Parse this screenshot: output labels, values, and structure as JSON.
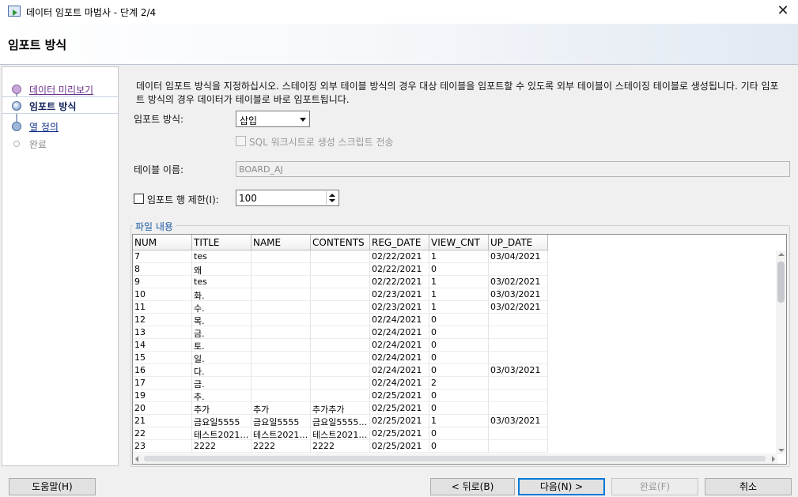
{
  "window": {
    "title": "데이터 임포트 마법사 - 단계 2/4",
    "close_glyph": "✕"
  },
  "header": {
    "title": "임포트 방식"
  },
  "nav": {
    "items": [
      {
        "label": "데이터 미리보기",
        "state": "done"
      },
      {
        "label": "임포트 방식",
        "state": "current"
      },
      {
        "label": "열 정의",
        "state": "next"
      },
      {
        "label": "완료",
        "state": "todo"
      }
    ]
  },
  "content": {
    "description": "데이터 임포트 방식을 지정하십시오. 스테이징 외부 테이블 방식의 경우 대상 테이블을 임포트할 수 있도록 외부 테이블이 스테이징 테이블로 생성됩니다. 기타 임포트 방식의 경우 데이터가 테이블로 바로 임포트됩니다.",
    "method_label": "임포트 방식:",
    "method_value": "삽입",
    "sql_script_label": "SQL 워크시트로 생성 스크립트 전송",
    "table_name_label": "테이블 이름:",
    "table_name_value": "BOARD_AJ",
    "limit_rows_label": "임포트 행 제한(I):",
    "limit_rows_value": "100",
    "file_contents_label": "파일 내용"
  },
  "table": {
    "columns": [
      "NUM",
      "TITLE",
      "NAME",
      "CONTENTS",
      "REG_DATE",
      "VIEW_CNT",
      "UP_DATE"
    ],
    "rows": [
      [
        "7",
        "tes",
        "",
        "",
        "02/22/2021",
        "1",
        "03/04/2021"
      ],
      [
        "8",
        "왜",
        "",
        "",
        "02/22/2021",
        "0",
        ""
      ],
      [
        "9",
        "tes",
        "",
        "",
        "02/22/2021",
        "1",
        "03/02/2021"
      ],
      [
        "10",
        "화.",
        "",
        "",
        "02/23/2021",
        "1",
        "03/03/2021"
      ],
      [
        "11",
        "수.",
        "",
        "",
        "02/23/2021",
        "1",
        "03/02/2021"
      ],
      [
        "12",
        "목.",
        "",
        "",
        "02/24/2021",
        "0",
        ""
      ],
      [
        "13",
        "금.",
        "",
        "",
        "02/24/2021",
        "0",
        ""
      ],
      [
        "14",
        "토.",
        "",
        "",
        "02/24/2021",
        "0",
        ""
      ],
      [
        "15",
        "일.",
        "",
        "",
        "02/24/2021",
        "0",
        ""
      ],
      [
        "16",
        "다.",
        "",
        "",
        "02/24/2021",
        "0",
        "03/03/2021"
      ],
      [
        "17",
        "금.",
        "",
        "",
        "02/24/2021",
        "2",
        ""
      ],
      [
        "19",
        "추.",
        "",
        "",
        "02/25/2021",
        "0",
        ""
      ],
      [
        "20",
        "추가",
        "추가",
        "추가추가",
        "02/25/2021",
        "0",
        ""
      ],
      [
        "21",
        "금요일5555",
        "금요일5555",
        "금요일5555,...",
        "02/25/2021",
        "1",
        "03/03/2021"
      ],
      [
        "22",
        "테스트2021,...",
        "테스트2021,...",
        "테스트2021,...",
        "02/25/2021",
        "0",
        ""
      ],
      [
        "23",
        "2222",
        "2222",
        "2222",
        "02/25/2021",
        "0",
        ""
      ]
    ]
  },
  "buttons": {
    "help": "도움말(H)",
    "back": "< 뒤로(B)",
    "next": "다음(N) >",
    "finish": "완료(F)",
    "cancel": "취소"
  }
}
